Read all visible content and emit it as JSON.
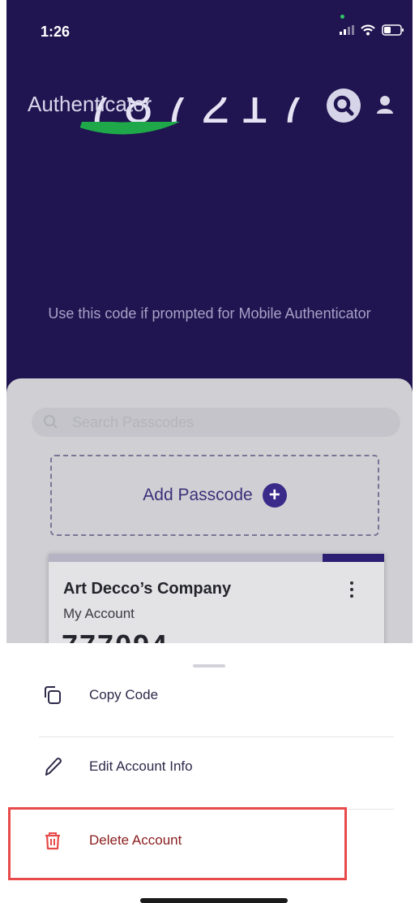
{
  "status_bar": {
    "time": "1:26"
  },
  "header": {
    "title": "Authenticator"
  },
  "hero": {
    "code_partial": "787217",
    "timer_fraction_remaining": 0.3,
    "hint": "Use this code if prompted for Mobile Authenticator"
  },
  "search": {
    "placeholder": "Search Passcodes"
  },
  "add_passcode": {
    "label": "Add Passcode",
    "icon": "plus-circle-icon"
  },
  "account_card": {
    "company": "Art Decco’s Company",
    "account": "My Account",
    "code_partial": "777094"
  },
  "sheet": {
    "items": [
      {
        "label": "Copy Code",
        "icon": "copy-icon"
      },
      {
        "label": "Edit Account Info",
        "icon": "pencil-icon"
      },
      {
        "label": "Delete Account",
        "icon": "trash-icon"
      }
    ]
  },
  "colors": {
    "hero_bg": "#201550",
    "timer_green": "#1fa84a",
    "accent": "#3a2a8a",
    "danger": "#e84a4a"
  }
}
